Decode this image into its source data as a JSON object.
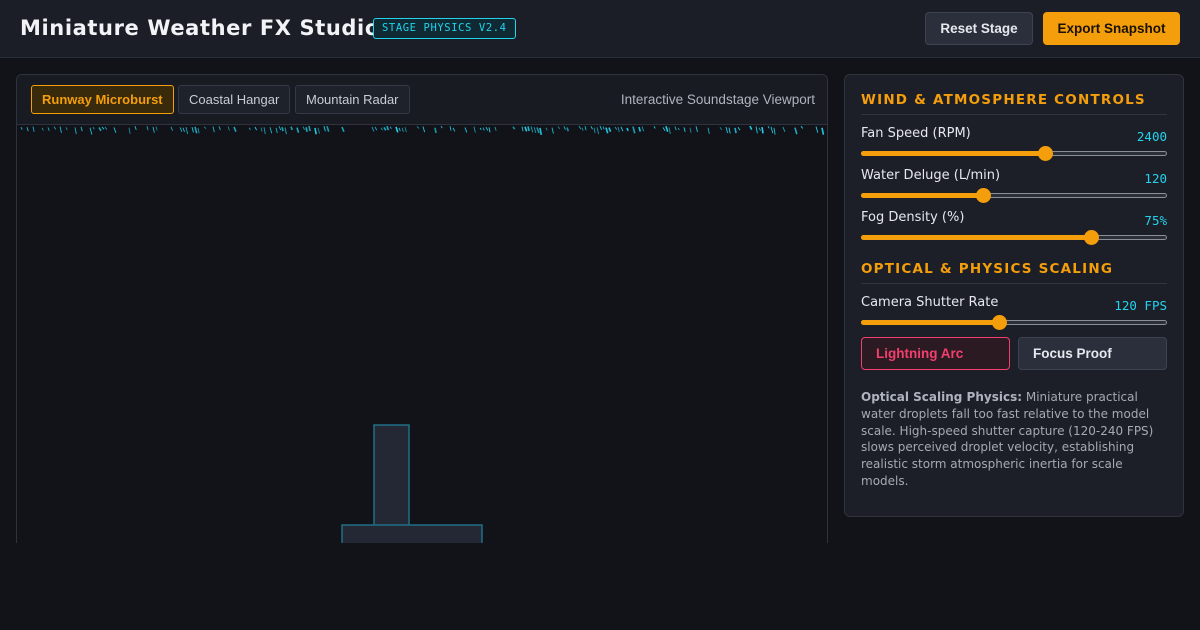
{
  "header": {
    "app_title": "Miniature Weather FX Studio",
    "version_badge": "STAGE PHYSICS V2.4",
    "reset_label": "Reset Stage",
    "export_label": "Export Snapshot"
  },
  "viewport": {
    "tabs": [
      {
        "label": "Runway Microburst",
        "active": true
      },
      {
        "label": "Coastal Hangar",
        "active": false
      },
      {
        "label": "Mountain Radar",
        "active": false
      }
    ],
    "label": "Interactive Soundstage Viewport",
    "rain_color": "#22d3ee"
  },
  "controls": {
    "wind_section_title": "WIND & ATMOSPHERE CONTROLS",
    "optical_section_title": "OPTICAL & PHYSICS SCALING",
    "sliders": [
      {
        "label": "Fan Speed (RPM)",
        "value": "2400",
        "level": 0.6
      },
      {
        "label": "Water Deluge (L/min)",
        "value": "120",
        "level": 0.4
      },
      {
        "label": "Fog Density (%)",
        "value": "75%",
        "level": 0.75
      },
      {
        "label": "Camera Shutter Rate",
        "value": "120 FPS",
        "level": 0.45
      }
    ],
    "lightning_label": "Lightning Arc",
    "focus_label": "Focus Proof",
    "info_heading": "Optical Scaling Physics:",
    "info_body": "Miniature practical water droplets fall too fast relative to the model scale. High-speed shutter capture (120-240 FPS) slows perceived droplet velocity, establishing realistic storm atmospheric inertia for scale models."
  },
  "colors": {
    "accent": "#f59e0b",
    "cyan": "#22d3ee",
    "danger": "#f43f6e"
  }
}
